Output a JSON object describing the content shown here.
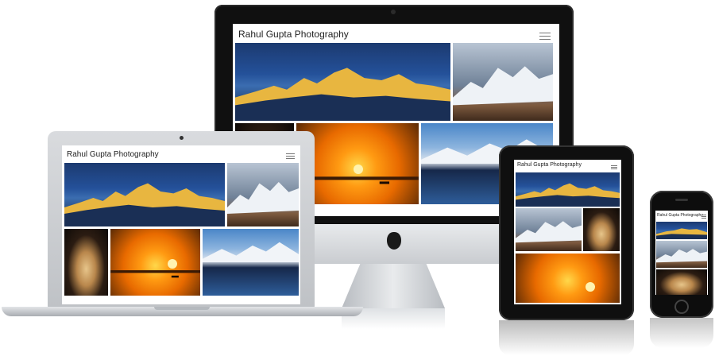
{
  "site": {
    "title": "Rahul Gupta Photography"
  },
  "photos": {
    "kangchenjunga": "mountain-sunrise-photo",
    "snow_range": "snow-mountain-photo",
    "sunset": "river-sunset-photo",
    "lake": "mountain-lake-photo",
    "arch": "arch-window-photo"
  },
  "colors": {
    "device_black": "#111111",
    "aluminum": "#c9ccd0",
    "sky_blue": "#24519a",
    "sunset_orange": "#ff9a12"
  }
}
